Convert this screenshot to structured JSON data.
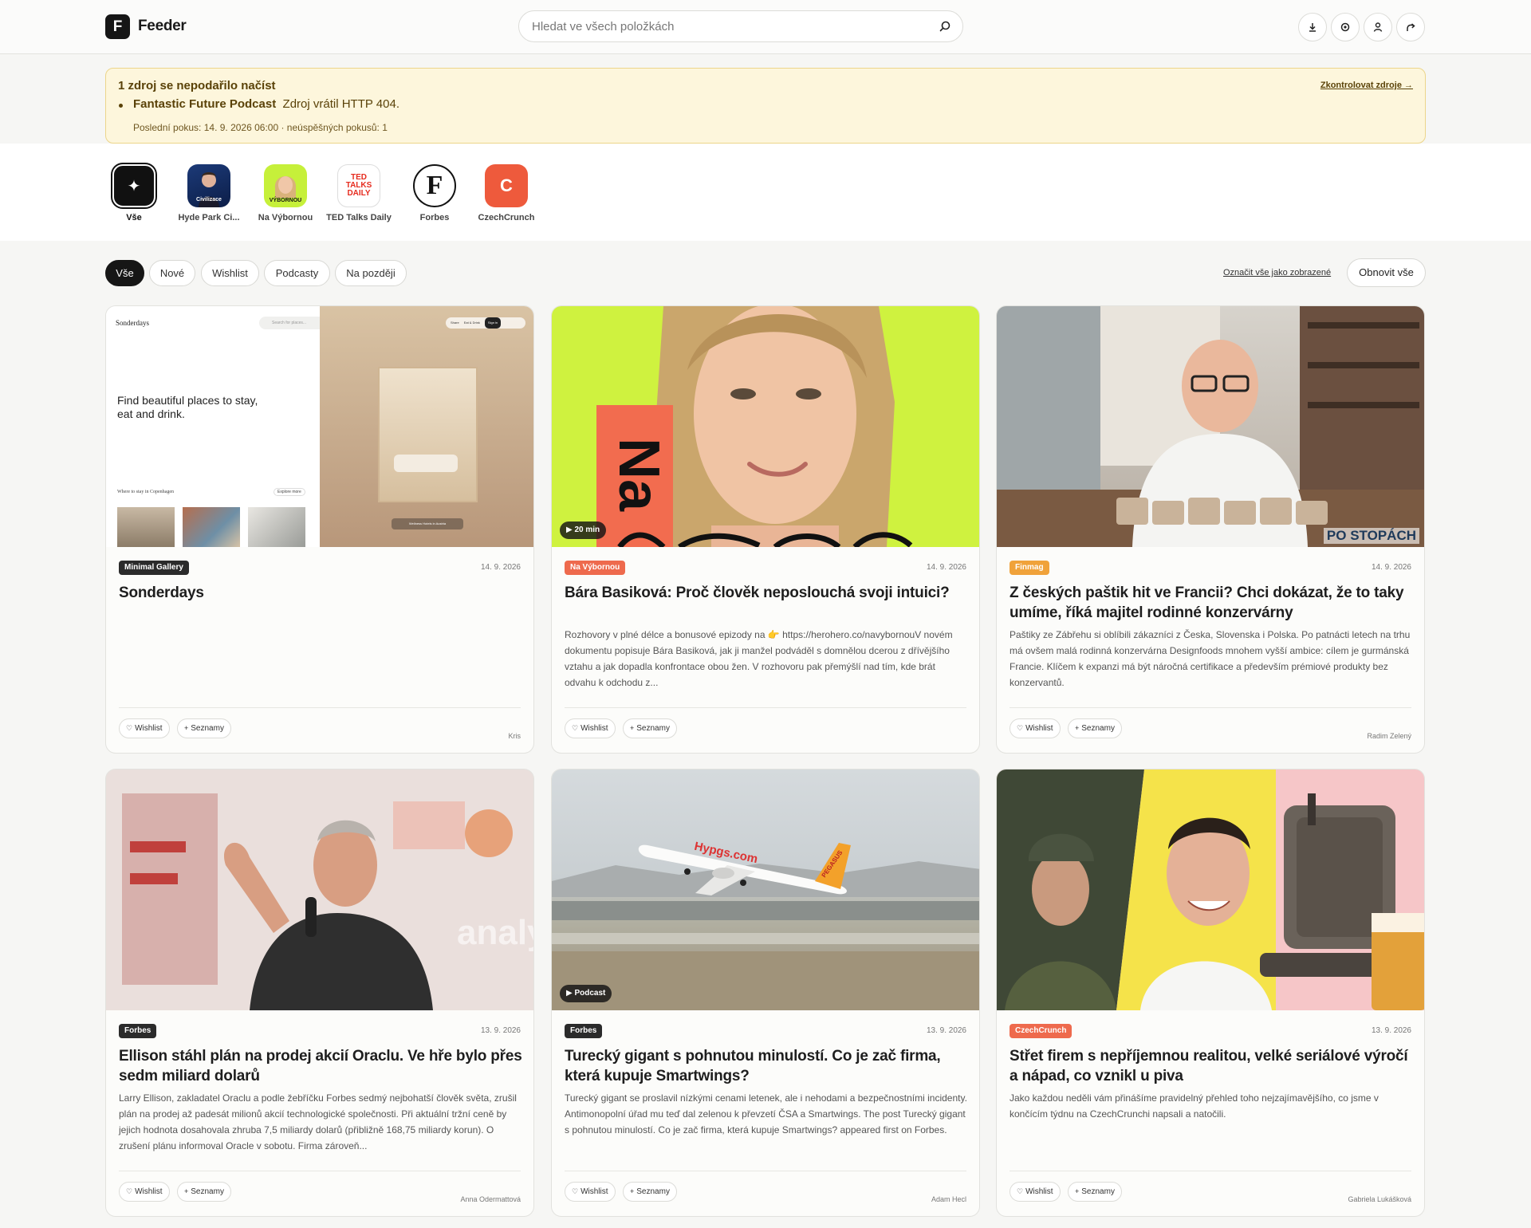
{
  "header": {
    "logo_letter": "F",
    "app_name": "Feeder",
    "search_placeholder": "Hledat ve všech položkách",
    "icons": [
      "download-icon",
      "settings-icon",
      "user-icon",
      "logout-icon"
    ]
  },
  "alert": {
    "title": "1 zdroj se nepodařilo načíst",
    "link": "Zkontrolovat zdroje →",
    "source_name": "Fantastic Future Podcast",
    "message": "Zdroj vrátil HTTP 404.",
    "detail": "Poslední pokus: 14. 9. 2026 06:00 · neúspěšných pokusů: 1"
  },
  "sources": [
    {
      "label": "Vše",
      "avatar_text": "✦"
    },
    {
      "label": "Hyde Park Ci...",
      "avatar_text": "Civilizace"
    },
    {
      "label": "Na Výbornou",
      "avatar_text": "VÝBORNOU"
    },
    {
      "label": "TED Talks Daily",
      "avatar_text": "TED TALKS DAILY"
    },
    {
      "label": "Forbes",
      "avatar_text": "F"
    },
    {
      "label": "CzechCrunch",
      "avatar_text": "C"
    }
  ],
  "filters": {
    "chips": [
      "Vše",
      "Nové",
      "Wishlist",
      "Podcasty",
      "Na později"
    ],
    "mark_all": "Označit vše jako zobrazené",
    "refresh": "Obnovit vše"
  },
  "card_actions": {
    "wishlist": "Wishlist",
    "lists": "Seznamy"
  },
  "thumb_text": {
    "sonderdays_logo": "Sonderdays",
    "sonderdays_search": "Search for places...",
    "sonderdays_hero": "Find beautiful places to stay, eat and drink.",
    "sonderdays_section": "Where to stay in Copenhagen",
    "sonderdays_explore": "Explore more",
    "sonderdays_nav": [
      "Share",
      "Eat & Drink",
      "Sign in"
    ],
    "sonderdays_caption": "Wellness Hotels in Austria",
    "na": "Na",
    "po_stopach": "PO STOPÁCH",
    "hypgs": "Hypgs.com",
    "pegasus": "PEGASUS",
    "analyt": "analyt"
  },
  "cards": [
    {
      "tag": "Minimal Gallery",
      "tag_color": "#2b2b2b",
      "date": "14. 9. 2026",
      "title": "Sonderdays",
      "description": "",
      "author": "Kris",
      "badge": ""
    },
    {
      "tag": "Na Výbornou",
      "tag_color": "#ee6a4d",
      "date": "14. 9. 2026",
      "title": "Bára Basiková: Proč člověk neposlouchá svoji intuici?",
      "description": "Rozhovory v plné délce a bonusové epizody na 👉 https://herohero.co/navybornouV novém dokumentu popisuje Bára Basiková, jak ji manžel podváděl s domnělou dcerou z dřívějšího vztahu a jak dopadla konfrontace obou žen. V rozhovoru pak přemýšlí nad tím, kde brát odvahu k odchodu z...",
      "author": "",
      "badge": "▶ 20 min"
    },
    {
      "tag": "Finmag",
      "tag_color": "#f0a23a",
      "date": "14. 9. 2026",
      "title": "Z českých paštik hit ve Francii? Chci dokázat, že to taky umíme, říká majitel rodinné konzervárny",
      "description": "Paštiky ze Zábřehu si oblíbili zákazníci z Česka, Slovenska i Polska. Po patnácti letech na trhu má ovšem malá rodinná konzervárna Designfoods mnohem vyšší ambice: cílem je gurmánská Francie. Klíčem k expanzi má být náročná certifikace a především prémiové produkty bez konzervantů.",
      "author": "Radim Zelený",
      "badge": ""
    },
    {
      "tag": "Forbes",
      "tag_color": "#2b2b2b",
      "date": "13. 9. 2026",
      "title": "Ellison stáhl plán na prodej akcií Oraclu. Ve hře bylo přes sedm miliard dolarů",
      "description": "Larry Ellison, zakladatel Oraclu a podle žebříčku Forbes sedmý nejbohatší člověk světa, zrušil plán na prodej až padesát milionů akcií technologické společnosti. Při aktuální tržní ceně by jejich hodnota dosahovala zhruba 7,5 miliardy dolarů (přibližně 168,75 miliardy korun). O zrušení plánu informoval Oracle v sobotu. Firma zároveň...",
      "author": "Anna Odermattová",
      "badge": ""
    },
    {
      "tag": "Forbes",
      "tag_color": "#2b2b2b",
      "date": "13. 9. 2026",
      "title": "Turecký gigant s pohnutou minulostí. Co je zač firma, která kupuje Smartwings?",
      "description": "Turecký gigant se proslavil nízkými cenami letenek, ale i nehodami a bezpečnostními incidenty. Antimonopolní úřad mu teď dal zelenou k převzetí ČSA a Smartwings. The post Turecký gigant s pohnutou minulostí. Co je zač firma, která kupuje Smartwings? appeared first on Forbes.",
      "author": "Adam Hecl",
      "badge": "▶ Podcast"
    },
    {
      "tag": "CzechCrunch",
      "tag_color": "#ee6a4d",
      "date": "13. 9. 2026",
      "title": "Střet firem s nepříjemnou realitou, velké seriálové výročí a nápad, co vznikl u piva",
      "description": "Jako každou neděli vám přinášíme pravidelný přehled toho nejzajímavějšího, co jsme v končícím týdnu na CzechCrunchi napsali a natočili.",
      "author": "Gabriela Lukášková",
      "badge": ""
    }
  ]
}
